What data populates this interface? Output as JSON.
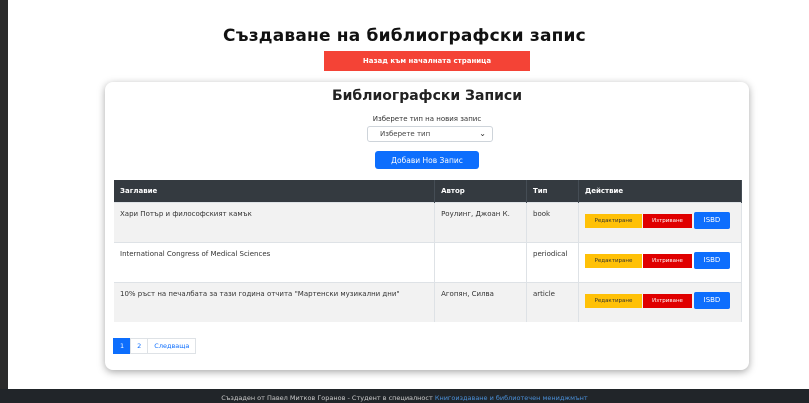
{
  "header": {
    "title": "Създаване на библиографски запис",
    "back_button": "Назад към началната страница"
  },
  "card": {
    "title": "Библиографски Записи",
    "choose_label": "Изберете тип на новия запис",
    "select_value": "Изберете тип",
    "add_button": "Добави Нов Запис"
  },
  "table": {
    "columns": [
      "Заглавие",
      "Автор",
      "Тип",
      "Действие"
    ],
    "rows": [
      {
        "title": "Хари Потър и философският камък",
        "author": "Роулинг, Джоан К.",
        "type": "book"
      },
      {
        "title": "International Congress of Medical Sciences",
        "author": "",
        "type": "periodical"
      },
      {
        "title": "10% ръст на печалбата за тази година отчита \"Мартенски музикални дни\"",
        "author": "Агопян, Силва",
        "type": "article"
      }
    ],
    "actions": {
      "edit": "Редактиране",
      "delete": "Изтриване",
      "isbd": "ISBD"
    }
  },
  "pagination": {
    "pages": [
      "1",
      "2"
    ],
    "next": "Следваща"
  },
  "footer": {
    "text": "Създаден от Павел Митков Горанов - Студент в специалност ",
    "link": "Книгоиздаване и библиотечен мениджмънт"
  },
  "colors": {
    "back_button": "#f44336",
    "primary": "#0d6efd",
    "edit": "#ffc107",
    "delete": "#e00000",
    "table_header": "#343a40",
    "footer": "#212529"
  }
}
